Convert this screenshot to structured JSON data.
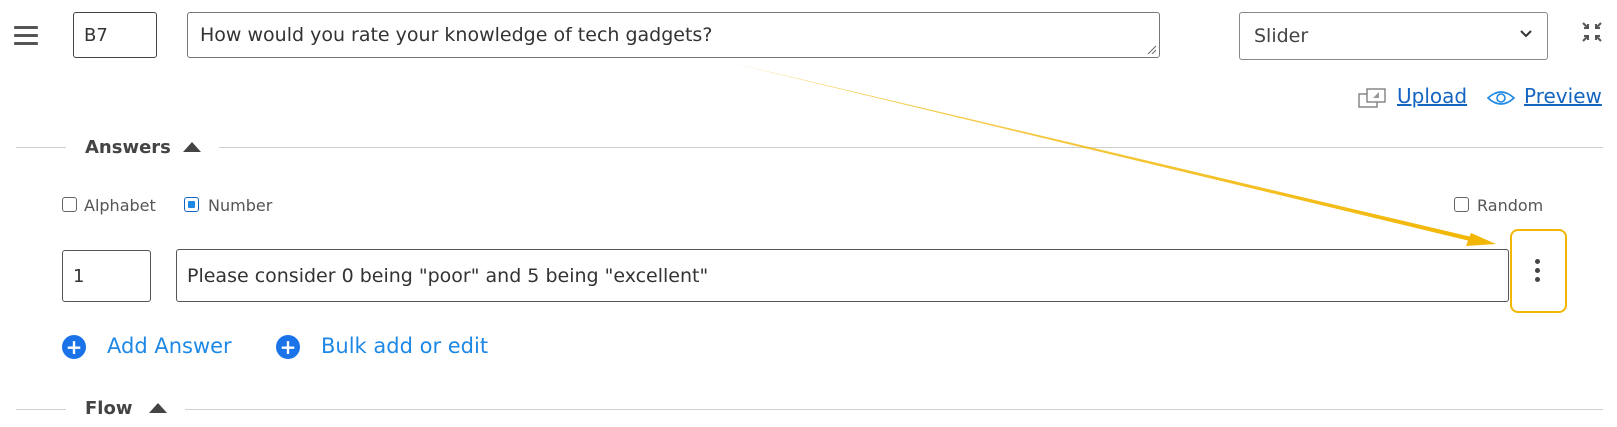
{
  "question": {
    "id": "B7",
    "text": "How would you rate your knowledge of tech gadgets?",
    "type": "Slider"
  },
  "links": {
    "upload": "Upload",
    "preview": "Preview"
  },
  "answers_section": {
    "title": "Answers",
    "options": {
      "alphabet": "Alphabet",
      "number": "Number",
      "random": "Random"
    },
    "items": [
      {
        "number": "1",
        "text": "Please consider 0 being \"poor\" and 5 being \"excellent\""
      }
    ],
    "add_answer": "Add Answer",
    "bulk_edit": "Bulk add or edit"
  },
  "flow_section": {
    "title": "Flow"
  },
  "colors": {
    "accent": "#1e88e5",
    "link": "#1565c0",
    "highlight": "#f2b705"
  }
}
